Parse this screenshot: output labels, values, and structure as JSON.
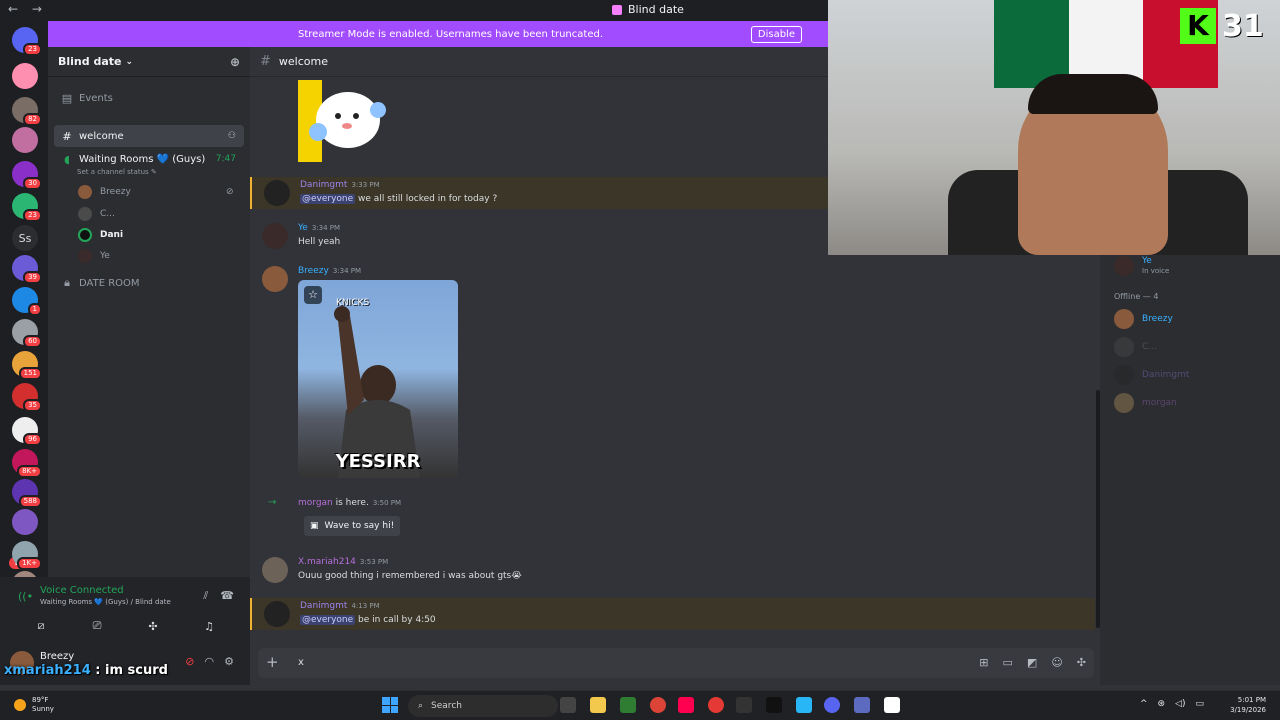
{
  "titlebar": {
    "back": "←",
    "forward": "→",
    "title": "Blind date"
  },
  "streamer_banner": {
    "message": "Streamer Mode is enabled. Usernames have been truncated.",
    "button": "Disable"
  },
  "servers": [
    {
      "badge": "23",
      "color": "#5865f2"
    },
    {
      "badge": "",
      "color": "#ff8fb0"
    },
    {
      "badge": "82",
      "color": "#7a6d66"
    },
    {
      "badge": "",
      "color": "#c06fa0"
    },
    {
      "badge": "30",
      "color": "#8b2fc9"
    },
    {
      "badge": "23",
      "color": "#2bb673"
    },
    {
      "badge": "39",
      "color": "#6b5bd6"
    },
    {
      "badge": "1",
      "color": "#1e88e5"
    },
    {
      "badge": "60",
      "color": "#9aa0a6"
    },
    {
      "badge": "151",
      "color": "#e8a33b"
    },
    {
      "badge": "35",
      "color": "#d32f2f"
    },
    {
      "badge": "96",
      "color": "#eeeeee"
    },
    {
      "badge": "8K+",
      "color": "#c2185b"
    },
    {
      "badge": "588",
      "color": "#5e35b1"
    },
    {
      "badge": "",
      "color": "#7e57c2"
    },
    {
      "badge": "1K+",
      "color": "#90a4ae"
    },
    {
      "badge": "",
      "color": "#a1887f"
    }
  ],
  "ss_server": "Ss",
  "new_badge": "NEW",
  "guild": {
    "name": "Blind date",
    "events": "Events",
    "channels": {
      "welcome": "welcome",
      "waiting": "Waiting Rooms 💙 (Guys)",
      "waiting_time": "7:47",
      "status_hint": "Set a channel status ✎",
      "date_room": "DATE ROOM"
    },
    "voice_users": [
      "Breezy",
      "C...",
      "Dani",
      "Ye"
    ]
  },
  "voice_panel": {
    "status": "Voice Connected",
    "location": "Waiting Rooms 💙 (Guys) / Blind date"
  },
  "user_panel": {
    "name": "Breezy"
  },
  "overlay": {
    "user": "xmariah214",
    "text": " : im scurd"
  },
  "chat": {
    "channel": "welcome",
    "messages": [
      {
        "author": "Danimgmt",
        "time": "3:33 PM",
        "mention": "@everyone",
        "text": " we all still locked in for today ?",
        "color": "#9b84ee"
      },
      {
        "author": "Ye",
        "time": "3:34 PM",
        "text": "Hell yeah",
        "color": "#3ab0ff"
      },
      {
        "author": "Breezy",
        "time": "3:34 PM",
        "text": "",
        "color": "#3ab0ff"
      },
      {
        "author": "morgan",
        "time": "3:50 PM",
        "text": " is here.",
        "color": "#b56fd9"
      },
      {
        "author": "X.mariah214",
        "time": "3:53 PM",
        "text": "Ouuu good thing i remembered i was about gts😭",
        "color": "#b56fd9"
      },
      {
        "author": "Danimgmt",
        "time": "4:13 PM",
        "mention": "@everyone",
        "text": " be in call by 4:50",
        "color": "#9b84ee"
      }
    ],
    "gif": {
      "top_text": "KNICKS",
      "caption": "YESSIRR"
    },
    "wave_button": "Wave to say hi!",
    "composer_text": "x"
  },
  "webcam": {
    "badge_number": "31",
    "badge_letter": "K"
  },
  "members": {
    "top_user": "Ye",
    "top_status": "In voice",
    "offline_header": "Offline — 4",
    "offline": [
      "Breezy",
      "C...",
      "Danimgmt",
      "morgan"
    ]
  },
  "taskbar": {
    "temp": "89°F",
    "condition": "Sunny",
    "search": "Search",
    "time": "5:01 PM",
    "date": "3/19/2026"
  }
}
